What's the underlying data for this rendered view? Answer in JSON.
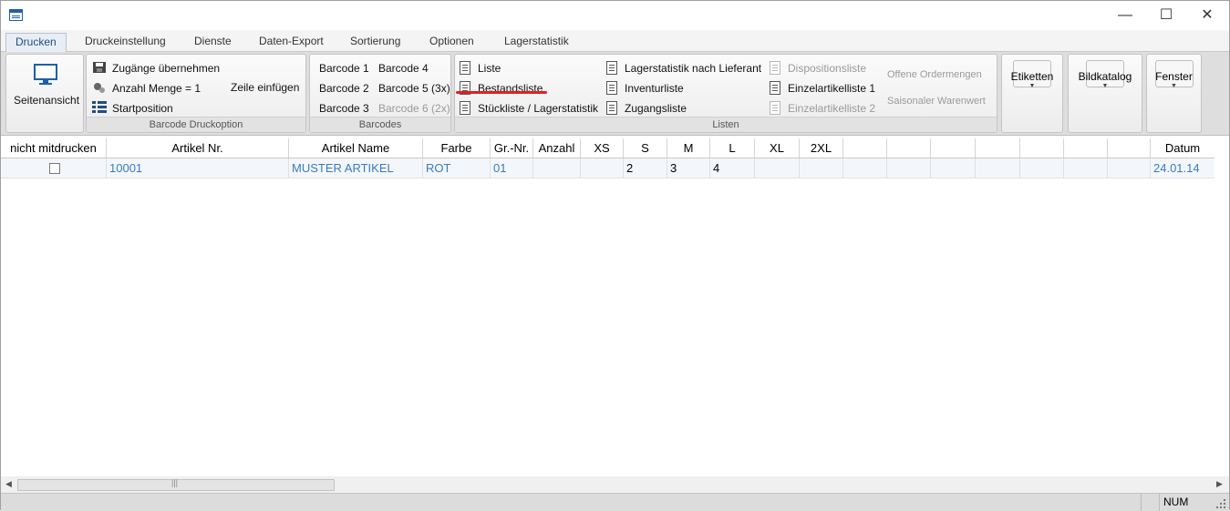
{
  "window": {
    "minimize": "—",
    "maximize": "☐",
    "close": "✕"
  },
  "tabs": [
    "Drucken",
    "Druckeinstellung",
    "Dienste",
    "Daten-Export",
    "Sortierung",
    "Optionen",
    "Lagerstatistik"
  ],
  "ribbon": {
    "seitenansicht": "Seitenansicht",
    "barcode_druckoption": {
      "label": "Barcode Druckoption",
      "zugaenge": "Zugänge übernehmen",
      "anzahl": "Anzahl Menge = 1",
      "zeile": "Zeile einfügen",
      "startposition": "Startposition"
    },
    "barcodes": {
      "label": "Barcodes",
      "items": [
        "Barcode 1",
        "Barcode 4",
        "Barcode 2",
        "Barcode 5 (3x)",
        "Barcode 3",
        "Barcode 6 (2x)"
      ]
    },
    "listen": {
      "label": "Listen",
      "items": [
        "Liste",
        "Lagerstatistik nach Lieferant",
        "Dispositionsliste",
        "Offene Ordermengen",
        "Bestandsliste",
        "Inventurliste",
        "Einzelartikelliste 1",
        "Saisonaler Warenwert",
        "Stückliste / Lagerstatistik",
        "Zugangsliste",
        "Einzelartikelliste 2"
      ]
    },
    "etiketten": "Etiketten",
    "bildkatalog": "Bildkatalog",
    "fenster": "Fenster"
  },
  "table": {
    "columns": [
      "nicht mitdrucken",
      "Artikel Nr.",
      "Artikel Name",
      "Farbe",
      "Gr.-Nr.",
      "Anzahl",
      "XS",
      "S",
      "M",
      "L",
      "XL",
      "2XL",
      "",
      "",
      "",
      "",
      "",
      "",
      "Datum"
    ],
    "rows": [
      {
        "checked": false,
        "artikel_nr": "10001",
        "artikel_name": "MUSTER ARTIKEL",
        "farbe": "ROT",
        "gr_nr": "01",
        "anzahl": "",
        "xs": "",
        "s": "2",
        "m": "3",
        "l": "4",
        "xl": "",
        "xxl": "",
        "datum": "24.01.14"
      }
    ]
  },
  "scroll_grip": "|||",
  "statusbar": {
    "num": "NUM"
  },
  "colors": {
    "accent": "#3a7ac0",
    "highlight": "#e02020"
  }
}
